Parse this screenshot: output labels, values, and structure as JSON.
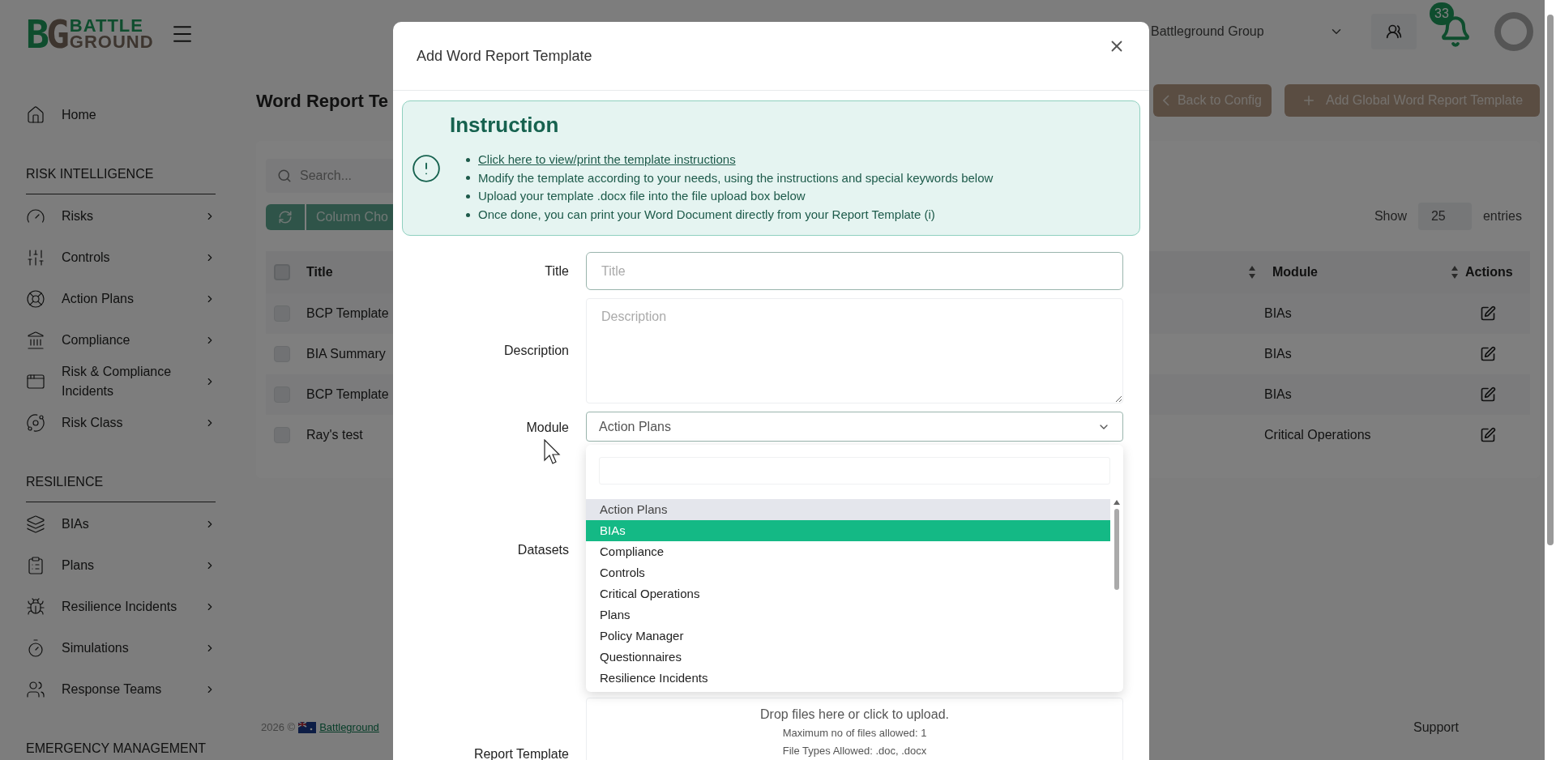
{
  "logo": {
    "mark_left": "B",
    "mark_right": "G",
    "line1": "BATTLE",
    "line2": "GROUND"
  },
  "header": {
    "org_selector": "Battleground Group",
    "notification_count": "33"
  },
  "sidebar": {
    "sections": [
      {
        "items": [
          {
            "label": "Home",
            "has_submenu": false
          }
        ]
      },
      {
        "heading": "RISK INTELLIGENCE",
        "items": [
          {
            "label": "Risks",
            "has_submenu": true
          },
          {
            "label": "Controls",
            "has_submenu": true
          },
          {
            "label": "Action Plans",
            "has_submenu": true
          },
          {
            "label": "Compliance",
            "has_submenu": true
          },
          {
            "label": "Risk & Compliance Incidents",
            "has_submenu": true
          },
          {
            "label": "Risk Class",
            "has_submenu": true
          }
        ]
      },
      {
        "heading": "RESILIENCE",
        "items": [
          {
            "label": "BIAs",
            "has_submenu": true
          },
          {
            "label": "Plans",
            "has_submenu": true
          },
          {
            "label": "Resilience Incidents",
            "has_submenu": true
          },
          {
            "label": "Simulations",
            "has_submenu": true
          },
          {
            "label": "Response Teams",
            "has_submenu": true
          }
        ]
      },
      {
        "heading": "EMERGENCY MANAGEMENT"
      }
    ]
  },
  "page": {
    "title": "Word Report Te",
    "buttons": [
      "Back to Config",
      "Add Global Word Report Template"
    ],
    "search": {
      "placeholder": "Search..."
    },
    "toolbar_button": "Column Cho",
    "page_size": {
      "before": "Show",
      "value": "25",
      "after": "entries"
    },
    "table": {
      "columns": [
        "Title",
        "Module",
        "Actions"
      ],
      "header_checked": false,
      "rows": [
        {
          "title": "BCP Template",
          "module": "BIAs",
          "checked": false
        },
        {
          "title": "BIA Summary",
          "module": "BIAs",
          "checked": false
        },
        {
          "title": "BCP Template",
          "module": "BIAs",
          "checked": false
        },
        {
          "title": "Ray's test",
          "module": "Critical Operations",
          "checked": false
        }
      ]
    },
    "footer": {
      "year": "2026 ©",
      "link": "Battleground",
      "support": "Support"
    }
  },
  "modal": {
    "title": "Add Word Report Template",
    "instruction": {
      "heading": "Instruction",
      "link": "Click here to view/print the template instructions",
      "bullets": [
        "Modify the template according to your needs, using the instructions and special keywords below",
        "Upload your template .docx file into the file upload box below",
        "Once done, you can print your Word Document directly from your Report Template (i)"
      ]
    },
    "title_field": {
      "label": "Title",
      "placeholder": "Title"
    },
    "description_field": {
      "label": "Description",
      "placeholder": "Description"
    },
    "module_field": {
      "label": "Module",
      "value": "Action Plans",
      "expanded": true,
      "options": [
        {
          "label": "Action Plans",
          "selected": true,
          "hovered": false
        },
        {
          "label": "BIAs",
          "selected": false,
          "hovered": true
        },
        {
          "label": "Compliance",
          "selected": false,
          "hovered": false
        },
        {
          "label": "Controls",
          "selected": false,
          "hovered": false
        },
        {
          "label": "Critical Operations",
          "selected": false,
          "hovered": false
        },
        {
          "label": "Plans",
          "selected": false,
          "hovered": false
        },
        {
          "label": "Policy Manager",
          "selected": false,
          "hovered": false
        },
        {
          "label": "Questionnaires",
          "selected": false,
          "hovered": false
        },
        {
          "label": "Resilience Incidents",
          "selected": false,
          "hovered": false
        }
      ]
    },
    "datasets_field": {
      "label": "Datasets"
    },
    "report_template_field": {
      "label": "Report Template",
      "drop_text": "Drop files here or click to upload.",
      "max_files": "Maximum no of files allowed: 1",
      "file_types": "File Types Allowed: .doc, .docx"
    }
  }
}
